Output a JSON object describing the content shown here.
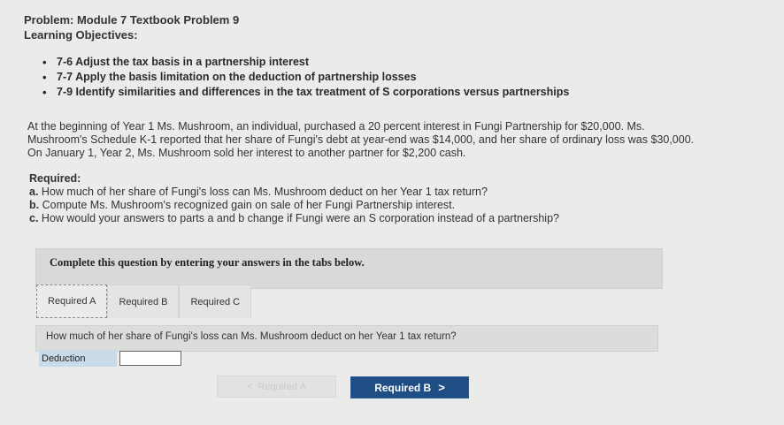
{
  "header": {
    "title": "Problem: Module 7 Textbook Problem 9",
    "subtitle": "Learning Objectives:"
  },
  "objectives": [
    "7-6 Adjust the tax basis in a partnership interest",
    "7-7 Apply the basis limitation on the deduction of partnership losses",
    "7-9 Identify similarities and differences in the tax treatment of S corporations versus partnerships"
  ],
  "problem_text": "At the beginning of Year 1 Ms. Mushroom, an individual, purchased a 20 percent interest in Fungi Partnership for $20,000. Ms. Mushroom's Schedule K-1 reported that her share of Fungi's debt at year-end was $14,000, and her share of ordinary loss was $30,000. On January 1, Year 2, Ms. Mushroom sold her interest to another partner for $2,200 cash.",
  "required": {
    "heading": "Required:",
    "parts": [
      {
        "letter": "a.",
        "text": "How much of her share of Fungi's loss can Ms. Mushroom deduct on her Year 1 tax return?"
      },
      {
        "letter": "b.",
        "text": "Compute Ms. Mushroom's recognized gain on sale of her Fungi Partnership interest."
      },
      {
        "letter": "c.",
        "text": "How would your answers to parts a and b change if Fungi were an S corporation instead of a partnership?"
      }
    ]
  },
  "instruction": "Complete this question by entering your answers in the tabs below.",
  "tabs": [
    "Required A",
    "Required B",
    "Required C"
  ],
  "question": "How much of her share of Fungi's loss can Ms. Mushroom deduct on her Year 1 tax return?",
  "deduction": {
    "label": "Deduction",
    "value": ""
  },
  "nav": {
    "prev_label": "Required A",
    "prev_arrow": "<",
    "next_label": "Required B",
    "next_arrow": ">"
  }
}
